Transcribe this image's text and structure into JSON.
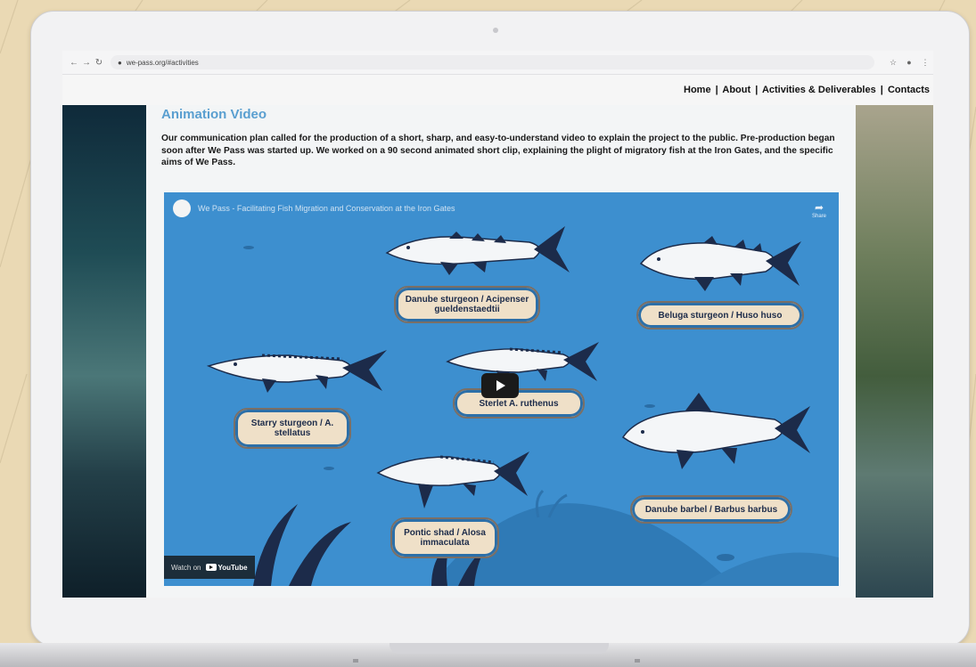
{
  "browser": {
    "url": "we-pass.org/#activities",
    "back_icon": "arrow-left-icon",
    "forward_icon": "arrow-right-icon",
    "reload_icon": "reload-icon"
  },
  "nav": {
    "items": [
      "Home",
      "About",
      "Activities & Deliverables",
      "Contacts"
    ],
    "separator": "|"
  },
  "section": {
    "title": "Animation Video",
    "body": "Our communication plan called for the production of a short, sharp, and easy-to-understand video to explain the project to the public. Pre-production began soon after We Pass was started up. We worked on a 90 second animated short clip, explaining the plight of migratory fish at the Iron Gates, and the specific aims of We Pass."
  },
  "video": {
    "title": "We Pass - Facilitating Fish Migration and Conservation at the Iron Gates",
    "share_label": "Share",
    "watch_on": "Watch on",
    "youtube": "YouTube",
    "labels": {
      "danube_sturgeon": "Danube sturgeon / Acipenser gueldenstaedtii",
      "beluga": "Beluga sturgeon / Huso huso",
      "sterlet": "Sterlet A. ruthenus",
      "starry": "Starry sturgeon / A. stellatus",
      "pontic": "Pontic shad / Alosa immaculata",
      "barbel": "Danube barbel / Barbus barbus"
    }
  },
  "colors": {
    "accent": "#5a9fd0",
    "video_bg": "#3d8fcf",
    "fish_dark": "#1c2b4a",
    "label_bg": "#efe0c8"
  }
}
